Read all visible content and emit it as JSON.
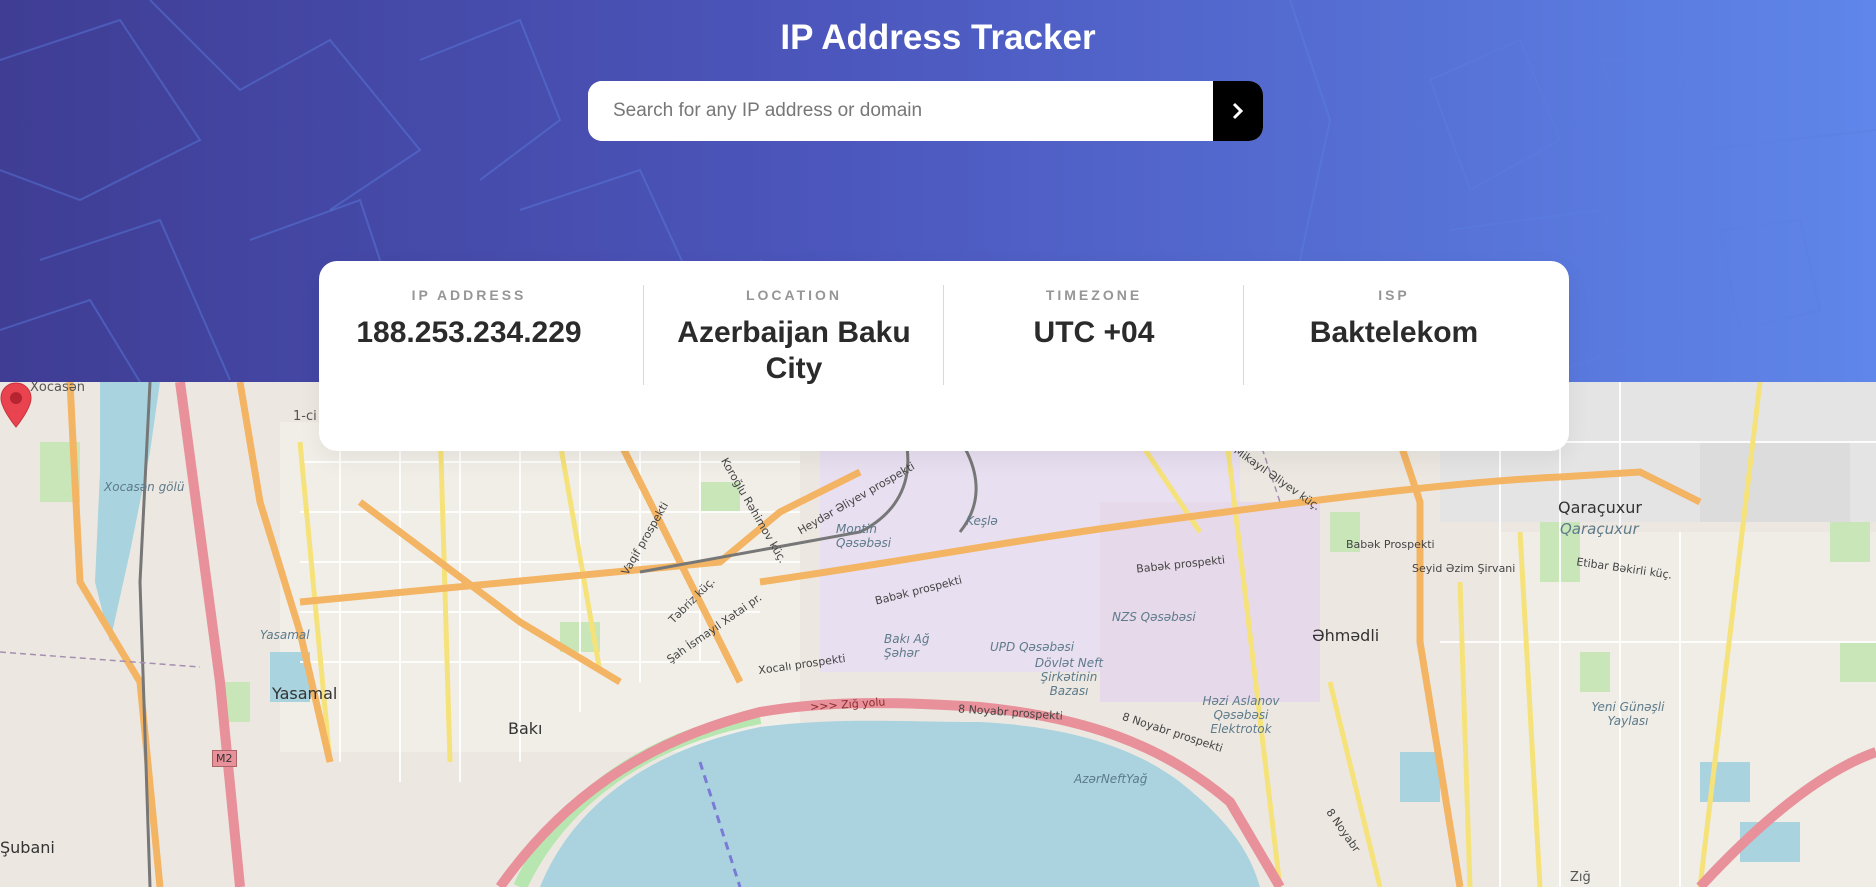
{
  "header": {
    "title": "IP Address Tracker",
    "search_placeholder": "Search for any IP address or domain",
    "search_button_icon": "chevron-right-icon"
  },
  "info": [
    {
      "label": "IP ADDRESS",
      "value": "188.253.234.229"
    },
    {
      "label": "LOCATION",
      "value": "Azerbaijan Baku City"
    },
    {
      "label": "TIMEZONE",
      "value": "UTC +04"
    },
    {
      "label": "ISP",
      "value": "Baktelekom"
    }
  ],
  "map": {
    "marker_icon": "location-pin-icon",
    "labels": {
      "xocasan": "Xocasən",
      "one_ci": "1-ci",
      "xocasan_golu": "Xocasən gölü",
      "yasamal_small": "Yasamal",
      "yasamal": "Yasamal",
      "baki": "Bakı",
      "subani": "Şubani",
      "montin": "Montin Qəsəbəsi",
      "kesla": "Keşlə",
      "baki_ag_sahar": "Bakı Ağ Şəhər",
      "upd": "UPD Qəsəbəsi",
      "dovlet": "Dövlət Neft Şirkətinin Bazası",
      "nzs": "NZS Qəsəbəsi",
      "ehmedli": "Əhmədli",
      "hazi": "Həzi Aslanov Qəsəbəsi Elektrotok",
      "azerneftyag": "AzərNeftYağ",
      "qaracuxur": "Qaraçuxur",
      "qaracuxur_it": "Qaraçuxur",
      "yeni_gunesli": "Yeni Günəşli Yaylası",
      "babek1": "Babək prospekti",
      "babek2": "Babək prospekti",
      "babek3": "Babək Prospekti",
      "heydar": "Heydər Əliyev prospekti",
      "koroglu": "Koroğlu Rəhimov küç.",
      "vagif": "Vaqif prospekti",
      "tebriz": "Təbriz küç.",
      "sah_ismayil": "Şah İsmayıl Xətai pr.",
      "xocali": "Xocalı prospekti",
      "zig_yolu": ">>> Zığ yolu",
      "noyabr1": "8 Noyabr prospekti",
      "noyabr2": "8 Noyabr prospekti",
      "noyabr3": "8 Noyabr",
      "seyid": "Seyid Əzim Şirvani",
      "etibar": "Etibar Bəkirli küç.",
      "mikayil": "Mikayıl Əliyev küç.",
      "m2": "M2",
      "zig": "Zığ"
    }
  }
}
